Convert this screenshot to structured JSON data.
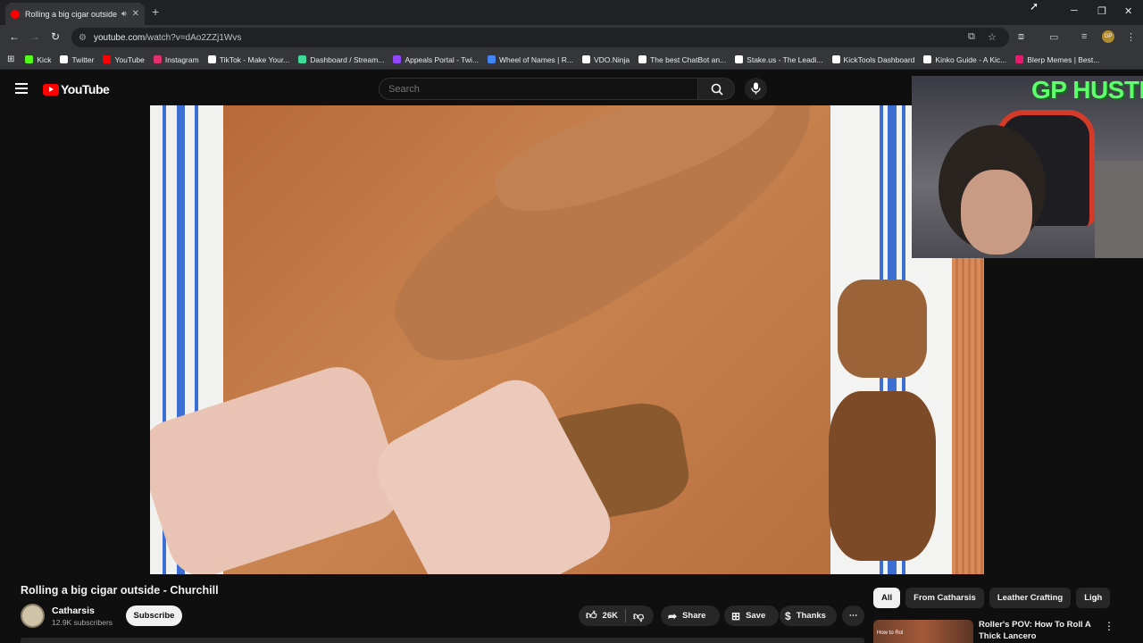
{
  "browser": {
    "tab_title": "Rolling a big cigar outside",
    "new_tab_icon": "plus-icon",
    "url_host": "youtube.com",
    "url_path": "/watch?v=dAo2ZZj1Wvs"
  },
  "bookmarks": [
    {
      "label": "Kick",
      "color": "#53fc18"
    },
    {
      "label": "Twitter",
      "color": "#ffffff"
    },
    {
      "label": "YouTube",
      "color": "#ff0000"
    },
    {
      "label": "Instagram",
      "color": "#e1306c"
    },
    {
      "label": "TikTok - Make Your...",
      "color": "#ffffff"
    },
    {
      "label": "Dashboard / Stream...",
      "color": "#3ddc97"
    },
    {
      "label": "Appeals Portal - Twi...",
      "color": "#9146ff"
    },
    {
      "label": "Wheel of Names | R...",
      "color": "#4285f4"
    },
    {
      "label": "VDO.Ninja",
      "color": "#ffffff"
    },
    {
      "label": "The best ChatBot an...",
      "color": "#ffffff"
    },
    {
      "label": "Stake.us - The Leadi...",
      "color": "#ffffff"
    },
    {
      "label": "KickTools Dashboard",
      "color": "#ffffff"
    },
    {
      "label": "Kinko Guide - A Kic...",
      "color": "#ffffff"
    },
    {
      "label": "Blerp Memes | Best...",
      "color": "#e8196b"
    }
  ],
  "youtube": {
    "logo_text": "YouTube",
    "search_placeholder": "Search"
  },
  "stream_overlay": {
    "text": "GP HUSTLA"
  },
  "video": {
    "title": "Rolling a big cigar outside - Churchill",
    "channel_name": "Catharsis",
    "subscribers": "12.9K subscribers",
    "subscribe_label": "Subscribe",
    "likes": "26K",
    "share_label": "Share",
    "save_label": "Save",
    "thanks_label": "Thanks"
  },
  "chips": [
    "All",
    "From Catharsis",
    "Leather Crafting",
    "Ligh"
  ],
  "recommendation": {
    "title": "Roller's POV: How To Roll A Thick Lancero",
    "thumb_text": "How to Rol"
  },
  "colors": {
    "brand_red": "#ff0000",
    "overlay_green": "#5dff6a",
    "background": "#0f0f0f"
  }
}
